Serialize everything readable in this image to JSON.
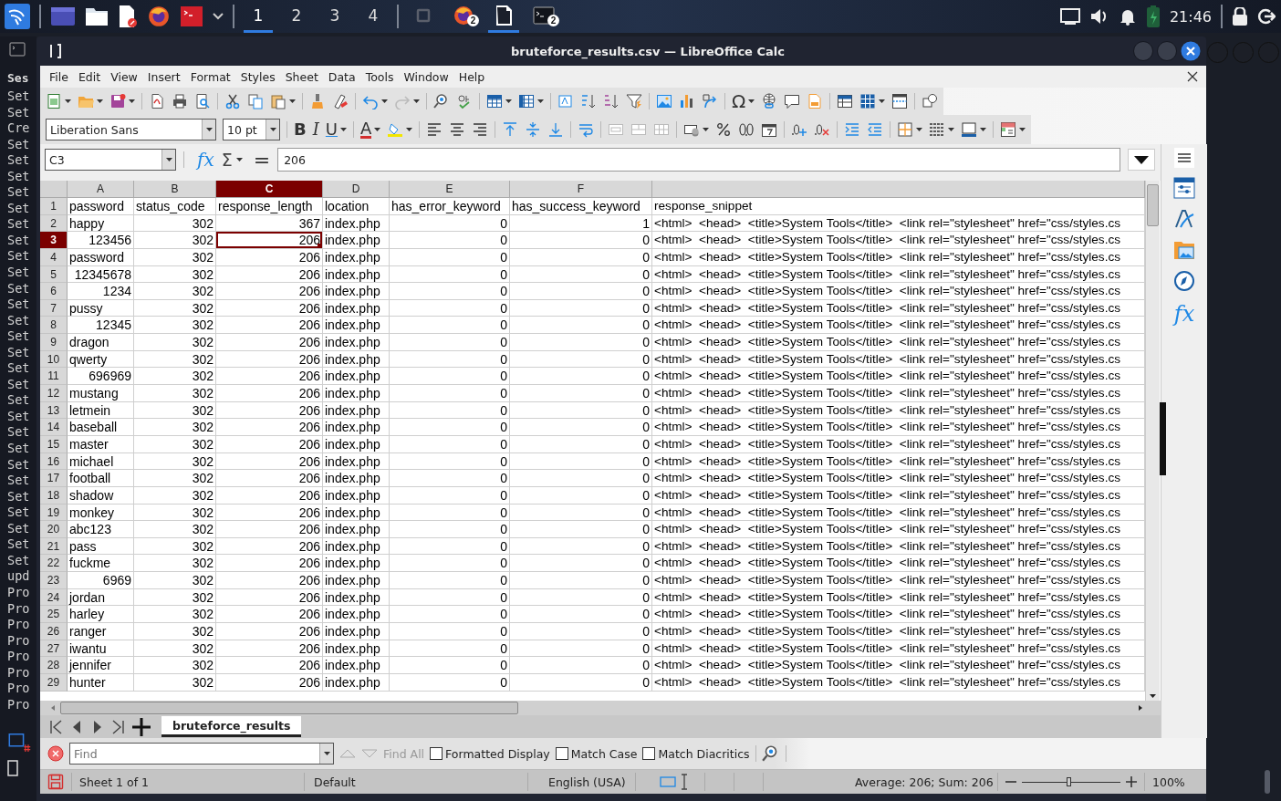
{
  "taskbar": {
    "workspaces": [
      {
        "label": "1",
        "selected": true
      },
      {
        "label": "2",
        "selected": false
      },
      {
        "label": "3",
        "selected": false
      },
      {
        "label": "4",
        "selected": false
      }
    ],
    "tasks": [
      {
        "kind": "window",
        "selected": false
      },
      {
        "kind": "browser",
        "badge": "2",
        "selected": false
      },
      {
        "kind": "document",
        "selected": true
      },
      {
        "kind": "terminal",
        "badge": "2",
        "selected": false
      }
    ],
    "clock": "21:46"
  },
  "terminal_behind": {
    "title": "Ses",
    "lines": [
      "Set",
      "Set",
      "Cre",
      "Set",
      "Set",
      "Set",
      "Set",
      "Set",
      "Set",
      "Set",
      "Set",
      "Set",
      "Set",
      "Set",
      "Set",
      "Set",
      "Set",
      "Set",
      "Set",
      "Set",
      "Set",
      "Set",
      "Set",
      "Set",
      "Set",
      "Set",
      "Set",
      "Set",
      "Set",
      "Set",
      "upd",
      "Pro",
      "Pro",
      "Pro",
      "Pro",
      "Pro",
      "Pro",
      "Pro",
      "Pro"
    ]
  },
  "window": {
    "title": "bruteforce_results.csv — LibreOffice Calc"
  },
  "menu": [
    "File",
    "Edit",
    "View",
    "Insert",
    "Format",
    "Styles",
    "Sheet",
    "Data",
    "Tools",
    "Window",
    "Help"
  ],
  "toolbar": {
    "special_character": "Ω",
    "font_name": "Liberation Sans",
    "font_size": "10 pt",
    "style_buttons": [
      "B",
      "I",
      "U"
    ],
    "font_color": "A"
  },
  "formula_bar": {
    "name_box": "C3",
    "function_wizard": "fx",
    "sum": "Σ",
    "equals": "=",
    "content": "206"
  },
  "columns": [
    {
      "label": "A",
      "selected": false
    },
    {
      "label": "B",
      "selected": false
    },
    {
      "label": "C",
      "selected": true
    },
    {
      "label": "D",
      "selected": false
    },
    {
      "label": "E",
      "selected": false
    },
    {
      "label": "F",
      "selected": false
    }
  ],
  "rows": [
    {
      "number": "1",
      "kind": "header",
      "selected": false,
      "numeric_password": false,
      "cells": [
        "password",
        "status_code",
        "response_length",
        "location",
        "has_error_keyword",
        "has_success_keyword",
        "response_snippet"
      ]
    },
    {
      "number": "2",
      "kind": "data",
      "selected": false,
      "numeric_password": false,
      "cells": [
        "happy",
        "302",
        "367",
        "index.php",
        "0",
        "1",
        "<html>  <head>  <title>System Tools</title>  <link rel=\"stylesheet\" href=\"css/styles.cs"
      ]
    },
    {
      "number": "3",
      "kind": "data",
      "selected": true,
      "numeric_password": true,
      "cells": [
        "123456",
        "302",
        "206",
        "index.php",
        "0",
        "0",
        "<html>  <head>  <title>System Tools</title>  <link rel=\"stylesheet\" href=\"css/styles.cs"
      ]
    },
    {
      "number": "4",
      "kind": "data",
      "selected": false,
      "numeric_password": false,
      "cells": [
        "password",
        "302",
        "206",
        "index.php",
        "0",
        "0",
        "<html>  <head>  <title>System Tools</title>  <link rel=\"stylesheet\" href=\"css/styles.cs"
      ]
    },
    {
      "number": "5",
      "kind": "data",
      "selected": false,
      "numeric_password": true,
      "cells": [
        "12345678",
        "302",
        "206",
        "index.php",
        "0",
        "0",
        "<html>  <head>  <title>System Tools</title>  <link rel=\"stylesheet\" href=\"css/styles.cs"
      ]
    },
    {
      "number": "6",
      "kind": "data",
      "selected": false,
      "numeric_password": true,
      "cells": [
        "1234",
        "302",
        "206",
        "index.php",
        "0",
        "0",
        "<html>  <head>  <title>System Tools</title>  <link rel=\"stylesheet\" href=\"css/styles.cs"
      ]
    },
    {
      "number": "7",
      "kind": "data",
      "selected": false,
      "numeric_password": false,
      "cells": [
        "pussy",
        "302",
        "206",
        "index.php",
        "0",
        "0",
        "<html>  <head>  <title>System Tools</title>  <link rel=\"stylesheet\" href=\"css/styles.cs"
      ]
    },
    {
      "number": "8",
      "kind": "data",
      "selected": false,
      "numeric_password": true,
      "cells": [
        "12345",
        "302",
        "206",
        "index.php",
        "0",
        "0",
        "<html>  <head>  <title>System Tools</title>  <link rel=\"stylesheet\" href=\"css/styles.cs"
      ]
    },
    {
      "number": "9",
      "kind": "data",
      "selected": false,
      "numeric_password": false,
      "cells": [
        "dragon",
        "302",
        "206",
        "index.php",
        "0",
        "0",
        "<html>  <head>  <title>System Tools</title>  <link rel=\"stylesheet\" href=\"css/styles.cs"
      ]
    },
    {
      "number": "10",
      "kind": "data",
      "selected": false,
      "numeric_password": false,
      "cells": [
        "qwerty",
        "302",
        "206",
        "index.php",
        "0",
        "0",
        "<html>  <head>  <title>System Tools</title>  <link rel=\"stylesheet\" href=\"css/styles.cs"
      ]
    },
    {
      "number": "11",
      "kind": "data",
      "selected": false,
      "numeric_password": true,
      "cells": [
        "696969",
        "302",
        "206",
        "index.php",
        "0",
        "0",
        "<html>  <head>  <title>System Tools</title>  <link rel=\"stylesheet\" href=\"css/styles.cs"
      ]
    },
    {
      "number": "12",
      "kind": "data",
      "selected": false,
      "numeric_password": false,
      "cells": [
        "mustang",
        "302",
        "206",
        "index.php",
        "0",
        "0",
        "<html>  <head>  <title>System Tools</title>  <link rel=\"stylesheet\" href=\"css/styles.cs"
      ]
    },
    {
      "number": "13",
      "kind": "data",
      "selected": false,
      "numeric_password": false,
      "cells": [
        "letmein",
        "302",
        "206",
        "index.php",
        "0",
        "0",
        "<html>  <head>  <title>System Tools</title>  <link rel=\"stylesheet\" href=\"css/styles.cs"
      ]
    },
    {
      "number": "14",
      "kind": "data",
      "selected": false,
      "numeric_password": false,
      "cells": [
        "baseball",
        "302",
        "206",
        "index.php",
        "0",
        "0",
        "<html>  <head>  <title>System Tools</title>  <link rel=\"stylesheet\" href=\"css/styles.cs"
      ]
    },
    {
      "number": "15",
      "kind": "data",
      "selected": false,
      "numeric_password": false,
      "cells": [
        "master",
        "302",
        "206",
        "index.php",
        "0",
        "0",
        "<html>  <head>  <title>System Tools</title>  <link rel=\"stylesheet\" href=\"css/styles.cs"
      ]
    },
    {
      "number": "16",
      "kind": "data",
      "selected": false,
      "numeric_password": false,
      "cells": [
        "michael",
        "302",
        "206",
        "index.php",
        "0",
        "0",
        "<html>  <head>  <title>System Tools</title>  <link rel=\"stylesheet\" href=\"css/styles.cs"
      ]
    },
    {
      "number": "17",
      "kind": "data",
      "selected": false,
      "numeric_password": false,
      "cells": [
        "football",
        "302",
        "206",
        "index.php",
        "0",
        "0",
        "<html>  <head>  <title>System Tools</title>  <link rel=\"stylesheet\" href=\"css/styles.cs"
      ]
    },
    {
      "number": "18",
      "kind": "data",
      "selected": false,
      "numeric_password": false,
      "cells": [
        "shadow",
        "302",
        "206",
        "index.php",
        "0",
        "0",
        "<html>  <head>  <title>System Tools</title>  <link rel=\"stylesheet\" href=\"css/styles.cs"
      ]
    },
    {
      "number": "19",
      "kind": "data",
      "selected": false,
      "numeric_password": false,
      "cells": [
        "monkey",
        "302",
        "206",
        "index.php",
        "0",
        "0",
        "<html>  <head>  <title>System Tools</title>  <link rel=\"stylesheet\" href=\"css/styles.cs"
      ]
    },
    {
      "number": "20",
      "kind": "data",
      "selected": false,
      "numeric_password": false,
      "cells": [
        "abc123",
        "302",
        "206",
        "index.php",
        "0",
        "0",
        "<html>  <head>  <title>System Tools</title>  <link rel=\"stylesheet\" href=\"css/styles.cs"
      ]
    },
    {
      "number": "21",
      "kind": "data",
      "selected": false,
      "numeric_password": false,
      "cells": [
        "pass",
        "302",
        "206",
        "index.php",
        "0",
        "0",
        "<html>  <head>  <title>System Tools</title>  <link rel=\"stylesheet\" href=\"css/styles.cs"
      ]
    },
    {
      "number": "22",
      "kind": "data",
      "selected": false,
      "numeric_password": false,
      "cells": [
        "fuckme",
        "302",
        "206",
        "index.php",
        "0",
        "0",
        "<html>  <head>  <title>System Tools</title>  <link rel=\"stylesheet\" href=\"css/styles.cs"
      ]
    },
    {
      "number": "23",
      "kind": "data",
      "selected": false,
      "numeric_password": true,
      "cells": [
        "6969",
        "302",
        "206",
        "index.php",
        "0",
        "0",
        "<html>  <head>  <title>System Tools</title>  <link rel=\"stylesheet\" href=\"css/styles.cs"
      ]
    },
    {
      "number": "24",
      "kind": "data",
      "selected": false,
      "numeric_password": false,
      "cells": [
        "jordan",
        "302",
        "206",
        "index.php",
        "0",
        "0",
        "<html>  <head>  <title>System Tools</title>  <link rel=\"stylesheet\" href=\"css/styles.cs"
      ]
    },
    {
      "number": "25",
      "kind": "data",
      "selected": false,
      "numeric_password": false,
      "cells": [
        "harley",
        "302",
        "206",
        "index.php",
        "0",
        "0",
        "<html>  <head>  <title>System Tools</title>  <link rel=\"stylesheet\" href=\"css/styles.cs"
      ]
    },
    {
      "number": "26",
      "kind": "data",
      "selected": false,
      "numeric_password": false,
      "cells": [
        "ranger",
        "302",
        "206",
        "index.php",
        "0",
        "0",
        "<html>  <head>  <title>System Tools</title>  <link rel=\"stylesheet\" href=\"css/styles.cs"
      ]
    },
    {
      "number": "27",
      "kind": "data",
      "selected": false,
      "numeric_password": false,
      "cells": [
        "iwantu",
        "302",
        "206",
        "index.php",
        "0",
        "0",
        "<html>  <head>  <title>System Tools</title>  <link rel=\"stylesheet\" href=\"css/styles.cs"
      ]
    },
    {
      "number": "28",
      "kind": "data",
      "selected": false,
      "numeric_password": false,
      "cells": [
        "jennifer",
        "302",
        "206",
        "index.php",
        "0",
        "0",
        "<html>  <head>  <title>System Tools</title>  <link rel=\"stylesheet\" href=\"css/styles.cs"
      ]
    },
    {
      "number": "29",
      "kind": "data",
      "selected": false,
      "numeric_password": false,
      "cells": [
        "hunter",
        "302",
        "206",
        "index.php",
        "0",
        "0",
        "<html>  <head>  <title>System Tools</title>  <link rel=\"stylesheet\" href=\"css/styles.cs"
      ]
    }
  ],
  "sidebar": {
    "functions": "fx"
  },
  "sheet_tabs": [
    {
      "label": "bruteforce_results",
      "selected": true
    }
  ],
  "find_bar": {
    "placeholder": "Find",
    "find_all": "Find All",
    "options": [
      {
        "label": "Formatted Display",
        "checked": false
      },
      {
        "label": "Match Case",
        "checked": false
      },
      {
        "label": "Match Diacritics",
        "checked": false
      }
    ]
  },
  "status_bar": {
    "sheet": "Sheet 1 of 1",
    "page_style": "Default",
    "language": "English (USA)",
    "summary": "Average: 206; Sum: 206",
    "zoom": {
      "level": 0.48,
      "reading": "100%"
    }
  }
}
